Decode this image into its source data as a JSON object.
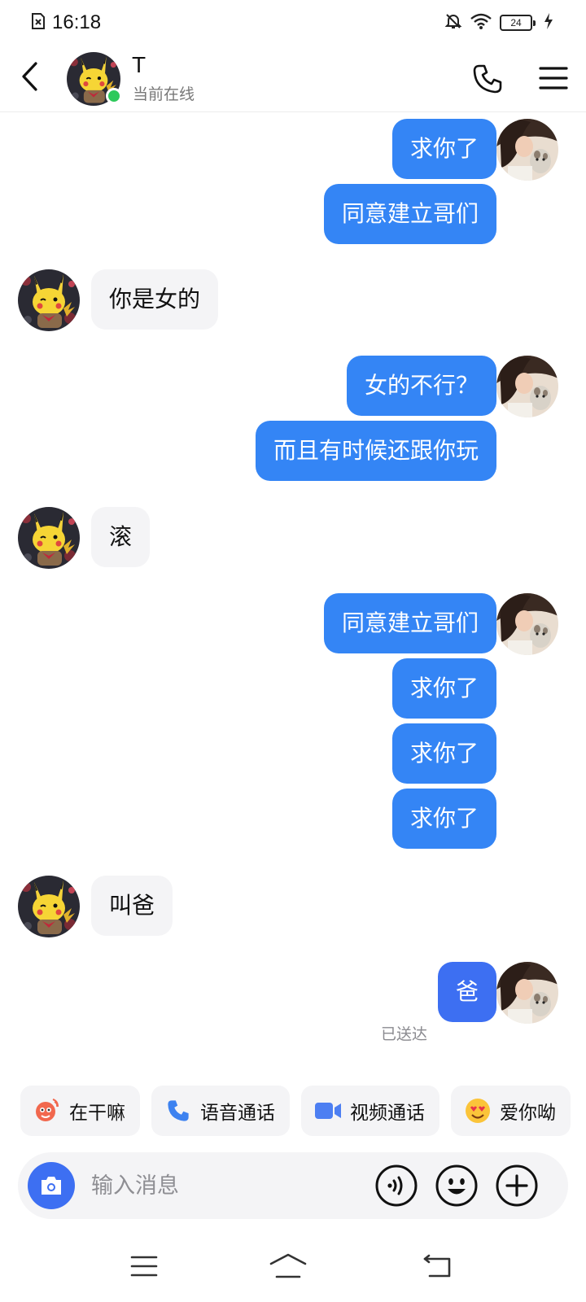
{
  "status_bar": {
    "time": "16:18",
    "battery_level": "24",
    "icons": [
      "sim-off-icon",
      "mute-bell-icon",
      "wifi-icon",
      "battery-icon",
      "charging-icon"
    ]
  },
  "header": {
    "contact_name": "T",
    "status_text": "当前在线",
    "online": true,
    "icons": [
      "back-arrow-icon",
      "phone-icon",
      "menu-icon"
    ]
  },
  "messages": [
    {
      "side": "me",
      "text": "求你了"
    },
    {
      "side": "me",
      "text": "同意建立哥们"
    },
    {
      "side": "them",
      "text": "你是女的"
    },
    {
      "side": "me",
      "text": "女的不行？"
    },
    {
      "side": "me",
      "text": "而且有时候还跟你玩"
    },
    {
      "side": "them",
      "text": "滚"
    },
    {
      "side": "me",
      "text": "同意建立哥们"
    },
    {
      "side": "me",
      "text": "求你了"
    },
    {
      "side": "me",
      "text": "求你了"
    },
    {
      "side": "me",
      "text": "求你了"
    },
    {
      "side": "them",
      "text": "叫爸"
    },
    {
      "side": "me",
      "text": "爸"
    }
  ],
  "delivered_label": "已送达",
  "quick_replies": [
    {
      "label": "在干嘛",
      "icon": "wave-emoji-icon"
    },
    {
      "label": "语音通话",
      "icon": "phone-icon"
    },
    {
      "label": "视频通话",
      "icon": "video-camera-icon"
    },
    {
      "label": "爱你呦",
      "icon": "heart-eyes-emoji-icon"
    }
  ],
  "composer": {
    "placeholder": "输入消息",
    "icons": [
      "camera-icon",
      "voice-icon",
      "emoji-icon",
      "plus-icon"
    ]
  },
  "nav_bar": {
    "icons": [
      "menu-lines-icon",
      "home-icon",
      "back-icon"
    ]
  },
  "colors": {
    "my_bubble": "#3485f5",
    "my_bubble_last": "#3d6ff2",
    "their_bubble": "#f4f4f6",
    "online_dot": "#2ec95b",
    "accent": "#3d6ff2"
  }
}
